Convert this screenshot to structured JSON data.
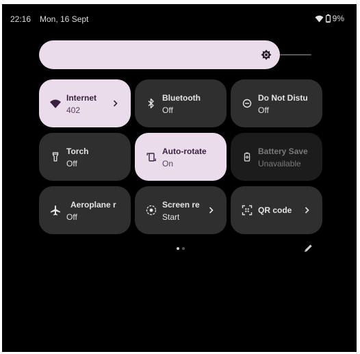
{
  "status_bar": {
    "time": "22:16",
    "date": "Mon, 16 Sept",
    "battery": "9%"
  },
  "brightness": {
    "level": 0.89,
    "icon": "brightness-icon"
  },
  "tiles": [
    {
      "label": "Internet",
      "sub": "402",
      "icon": "wifi-icon",
      "state": "active",
      "chevron": true
    },
    {
      "label": "Bluetooth",
      "sub": "Off",
      "icon": "bluetooth-icon",
      "state": "inactive",
      "chevron": false
    },
    {
      "label": "Do Not Distu",
      "sub": "Off",
      "icon": "do-not-disturb-icon",
      "state": "inactive",
      "chevron": false
    },
    {
      "label": "Torch",
      "sub": "Off",
      "icon": "torch-icon",
      "state": "inactive",
      "chevron": false
    },
    {
      "label": "Auto-rotate",
      "sub": "On",
      "icon": "auto-rotate-icon",
      "state": "active",
      "chevron": false
    },
    {
      "label": "Battery Save",
      "sub": "Unavailable",
      "icon": "battery-saver-icon",
      "state": "unavailable",
      "chevron": false
    },
    {
      "label": "Aeroplane r",
      "sub": "Off",
      "icon": "aeroplane-icon",
      "state": "inactive",
      "chevron": false
    },
    {
      "label": "Screen re",
      "sub": "Start",
      "icon": "screen-record-icon",
      "state": "inactive",
      "chevron": true
    },
    {
      "label": "QR code",
      "sub": "",
      "icon": "qr-code-icon",
      "state": "inactive",
      "chevron": true
    }
  ],
  "pager": {
    "pages": 2,
    "current": 1
  },
  "colors": {
    "background": "#000000",
    "tile_active": "#eadcea",
    "tile_inactive": "#2f2f2f",
    "tile_unavailable": "#1c1c1c"
  }
}
